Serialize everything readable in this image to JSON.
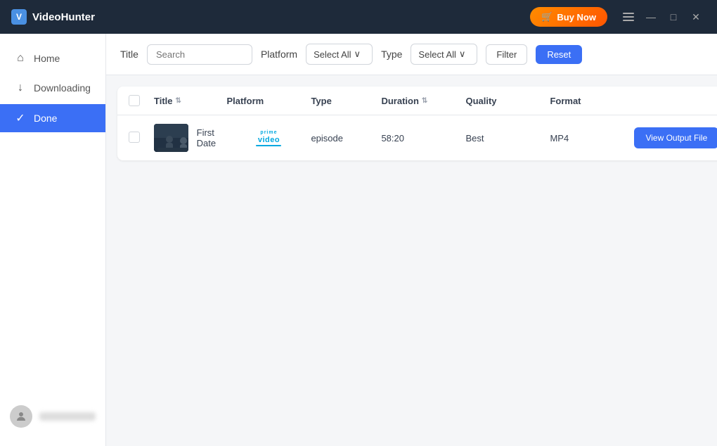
{
  "titlebar": {
    "app_name": "VideoHunter",
    "buy_now_label": "Buy Now",
    "cart_icon": "🛒",
    "menu_icon": "≡",
    "minimize_icon": "—",
    "maximize_icon": "□",
    "close_icon": "✕"
  },
  "sidebar": {
    "items": [
      {
        "id": "home",
        "label": "Home",
        "icon": "⊙",
        "active": false
      },
      {
        "id": "downloading",
        "label": "Downloading",
        "icon": "↓",
        "active": false
      },
      {
        "id": "done",
        "label": "Done",
        "icon": "✓",
        "active": true
      }
    ],
    "footer": {
      "avatar_icon": "👤",
      "username_placeholder": "username"
    }
  },
  "toolbar": {
    "title_label": "Title",
    "search_placeholder": "Search",
    "platform_label": "Platform",
    "platform_select": "Select All",
    "type_label": "Type",
    "type_select": "Select All",
    "filter_label": "Filter",
    "reset_label": "Reset"
  },
  "table": {
    "headers": [
      {
        "id": "checkbox",
        "label": ""
      },
      {
        "id": "title",
        "label": "Title",
        "sortable": true
      },
      {
        "id": "platform",
        "label": "Platform",
        "sortable": false
      },
      {
        "id": "type",
        "label": "Type",
        "sortable": false
      },
      {
        "id": "duration",
        "label": "Duration",
        "sortable": true
      },
      {
        "id": "quality",
        "label": "Quality",
        "sortable": false
      },
      {
        "id": "format",
        "label": "Format",
        "sortable": false
      },
      {
        "id": "action",
        "label": ""
      }
    ],
    "rows": [
      {
        "id": 1,
        "title": "First Date",
        "platform": "prime_video",
        "type": "episode",
        "duration": "58:20",
        "quality": "Best",
        "format": "MP4",
        "action_label": "View Output File"
      }
    ]
  },
  "colors": {
    "accent": "#3b6ff5",
    "buy_now_gradient_start": "#ff8c00",
    "buy_now_gradient_end": "#ff5500",
    "titlebar_bg": "#1e2a3a",
    "active_sidebar": "#3b6ff5",
    "prime_video_color": "#00a8e0"
  }
}
